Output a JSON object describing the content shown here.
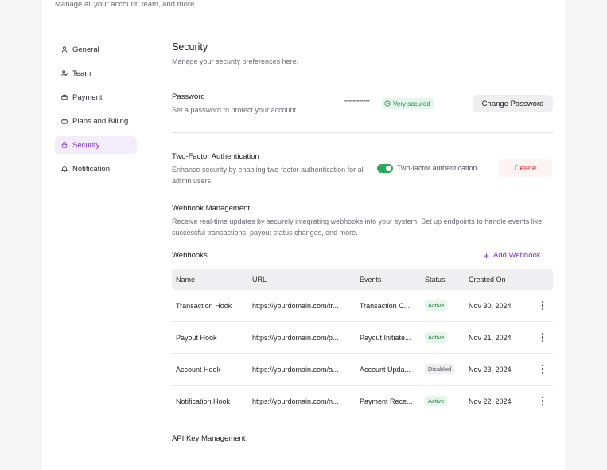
{
  "header": {
    "subtitle": "Manage all your account, team, and more"
  },
  "sidebar": {
    "items": [
      {
        "label": "General",
        "icon": "user-icon",
        "active": false
      },
      {
        "label": "Team",
        "icon": "team-icon",
        "active": false
      },
      {
        "label": "Payment",
        "icon": "wallet-icon",
        "active": false
      },
      {
        "label": "Plans and Billing",
        "icon": "bag-icon",
        "active": false
      },
      {
        "label": "Security",
        "icon": "shield-icon",
        "active": true
      },
      {
        "label": "Notification",
        "icon": "bell-icon",
        "active": false
      }
    ]
  },
  "security": {
    "title": "Security",
    "description": "Manage your security preferences here.",
    "password": {
      "label": "Password",
      "description": "Set a password to protect your account.",
      "masked": "************",
      "badge": "Very secured",
      "button": "Change Password"
    },
    "two_factor": {
      "label": "Two-Factor Authentication",
      "description": "Enhance security by enabling two-factor authentication for all admin users.",
      "toggle_label": "Two-factor authentication",
      "enabled": true,
      "delete_button": "Delete"
    },
    "webhooks": {
      "title": "Webhook Management",
      "description": "Receive real-time updates by securely integrating webhooks into your system. Set up endpoints to handle events like successful transactions, payout status changes, and more.",
      "list_title": "Webhooks",
      "add_button": "Add Webhook",
      "columns": [
        "Name",
        "URL",
        "Events",
        "Status",
        "Created On"
      ],
      "rows": [
        {
          "name": "Transaction Hook",
          "url": "https://yourdomain.com/tr...",
          "events": "Transaction C...",
          "status": "Active",
          "created": "Nov 30, 2024"
        },
        {
          "name": "Payout Hook",
          "url": "https://yourdomain.com/p...",
          "events": "Payout Initiate...",
          "status": "Active",
          "created": "Nov 21, 2024"
        },
        {
          "name": "Account Hook",
          "url": "https://yourdomain.com/a...",
          "events": "Account Upda...",
          "status": "Disabled",
          "created": "Nov 23, 2024"
        },
        {
          "name": "Notification Hook",
          "url": "https://yourdomain.com/n...",
          "events": "Payment Rece...",
          "status": "Active",
          "created": "Nov 22, 2024"
        }
      ]
    },
    "api_keys": {
      "title": "API Key Management"
    }
  },
  "colors": {
    "accent": "#7a2fd0",
    "success": "#1e8b45",
    "danger": "#d92a2a"
  }
}
